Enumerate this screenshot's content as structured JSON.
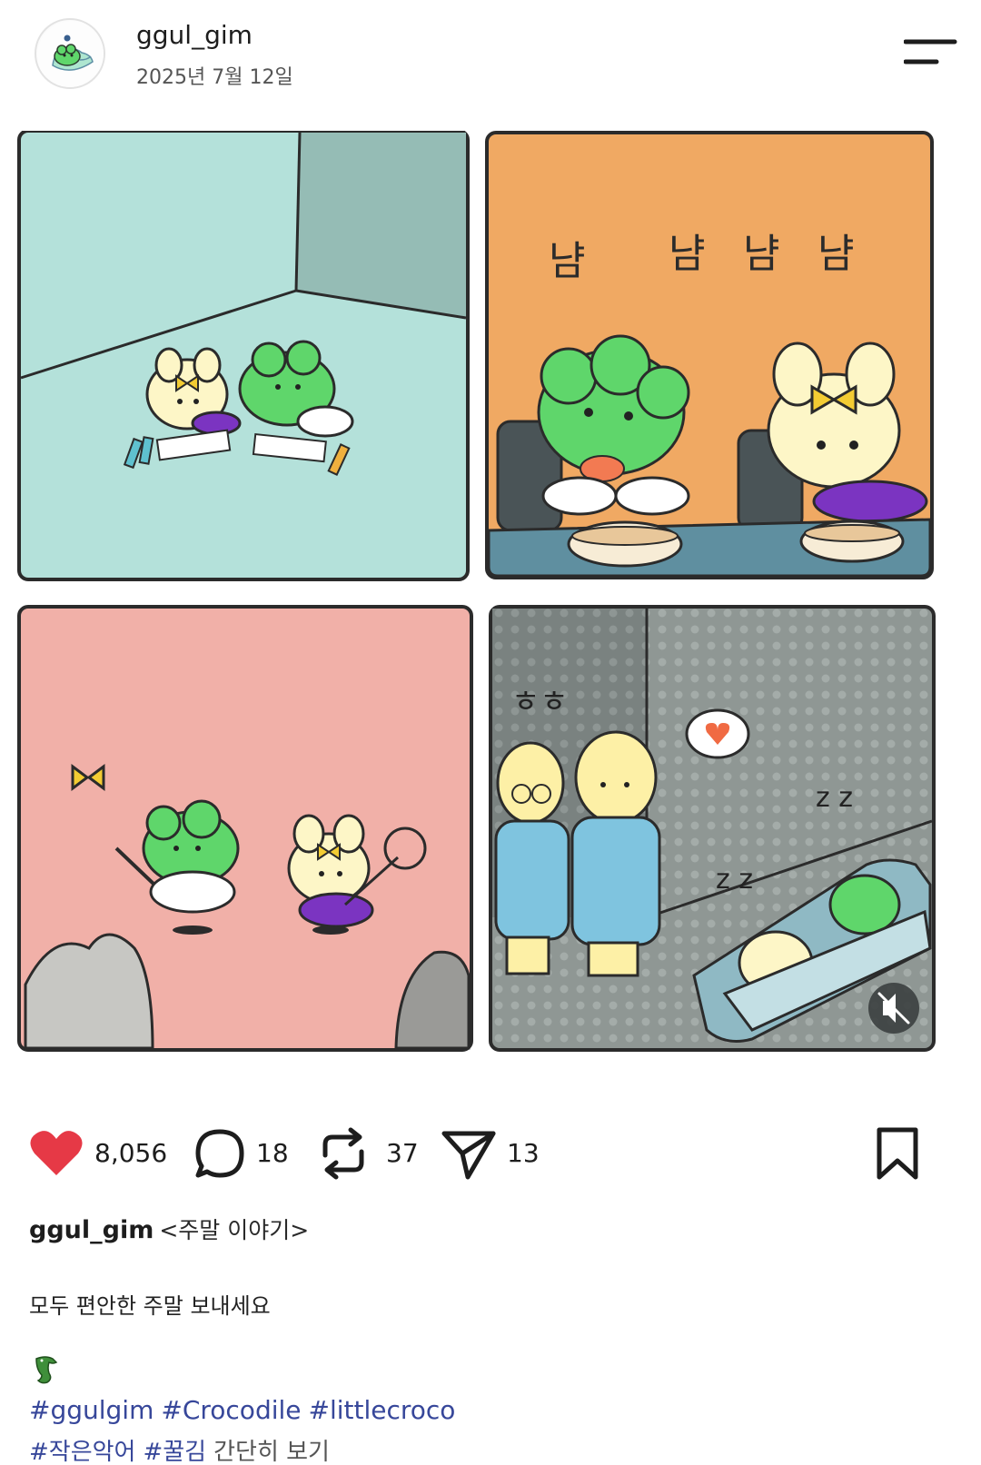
{
  "header": {
    "username": "ggul_gim",
    "date": "2025년 7월 12일",
    "avatar_icon": "crocodile-avatar-icon",
    "menu_icon": "menu-icon"
  },
  "comic": {
    "panel1_bg": "#b4e1da",
    "panel2_bg": "#f0a963",
    "panel2_text": [
      "냠",
      "냠",
      "냠",
      "냠"
    ],
    "panel3_bg": "#f1b0a8",
    "panel4_bg": "#8d9592",
    "panel4_text": "ㅎㅎ",
    "panel4_zzz1": "z z",
    "panel4_zzz2": "z z",
    "mute_icon": "mute-icon"
  },
  "actions": {
    "likes": "8,056",
    "comments": "18",
    "reposts": "37",
    "shares": "13",
    "like_color": "#e63946"
  },
  "caption": {
    "username": "ggul_gim",
    "title": "<주말 이야기>",
    "text": "모두 편안한 주말 보내세요",
    "tags_line1": [
      "#ggulgim",
      "#Crocodile",
      "#littlecroco"
    ],
    "tags_line2": [
      "#작은악어",
      "#꿀김"
    ],
    "more": "간단히 보기"
  }
}
